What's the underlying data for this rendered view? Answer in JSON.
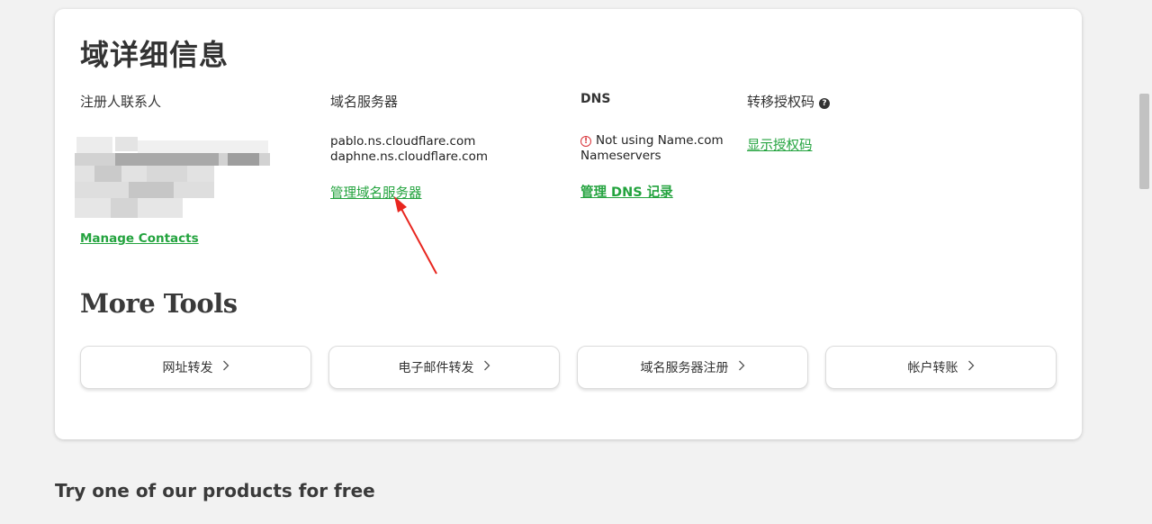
{
  "domain_details": {
    "title": "域详细信息",
    "registrant": {
      "label": "注册人联系人",
      "manage_link": "Manage Contacts"
    },
    "nameservers": {
      "label": "域名服务器",
      "list": [
        "pablo.ns.cloudflare.com",
        "daphne.ns.cloudflare.com"
      ],
      "manage_link": "管理域名服务器"
    },
    "dns": {
      "label": "DNS",
      "status_line1": "Not using Name.com",
      "status_line2": "Nameservers",
      "manage_link": "管理 DNS 记录"
    },
    "transfer_code": {
      "label": "转移授权码",
      "show_link": "显示授权码"
    }
  },
  "more_tools": {
    "title": "More Tools",
    "buttons": [
      "网址转发",
      "电子邮件转发",
      "域名服务器注册",
      "帐户转账"
    ]
  },
  "bottom": {
    "title": "Try one of our products for free"
  },
  "colors": {
    "link_green": "#23a33e",
    "warning_red": "#d9343a",
    "annotation_arrow": "#e8261f"
  },
  "icons": {
    "help": "question-circle-icon",
    "warning": "alert-circle-icon",
    "chevron": "chevron-right-icon"
  }
}
